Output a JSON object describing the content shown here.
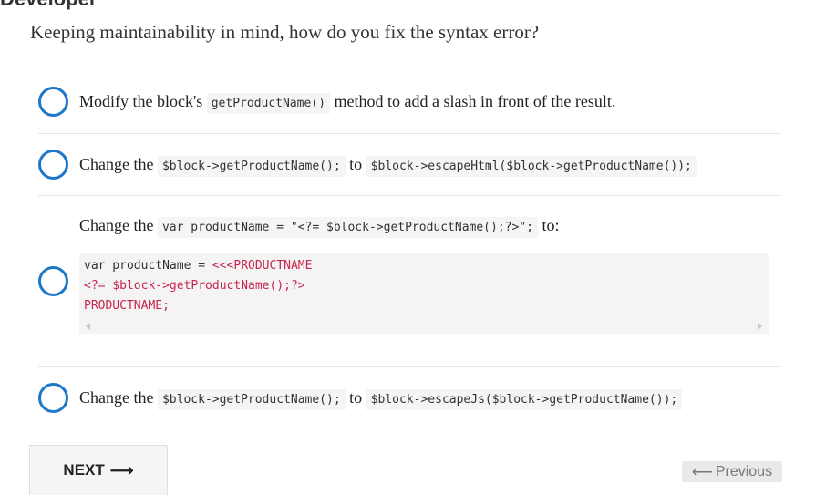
{
  "header": {
    "section_title": "Developer"
  },
  "question": "Keeping maintainability in mind, how do you fix the syntax error?",
  "options": [
    {
      "pre": "Modify the block's ",
      "code1": "getProductName()",
      "post": " method to add a slash in front of the result."
    },
    {
      "pre": "Change the ",
      "code1": "$block->getProductName();",
      "mid": " to ",
      "code2": "$block->escapeHtml($block->getProductName());"
    },
    {
      "pre": "Change the ",
      "code1": "var productName = \"<?= $block->getProductName();?>\";",
      "post": " to:",
      "code_block": {
        "line1_plain": "var productName = ",
        "line1_red": "<<<PRODUCTNAME",
        "line2_red": "<?= $block->getProductName();?>",
        "line3_red": "PRODUCTNAME;"
      }
    },
    {
      "pre": "Change the ",
      "code1": "$block->getProductName();",
      "mid": " to ",
      "code2": "$block->escapeJs($block->getProductName());"
    }
  ],
  "nav": {
    "next_label": "NEXT",
    "next_arrow": "⟶",
    "prev_arrow": "⟵",
    "prev_label": "Previous"
  },
  "colors": {
    "radio": "#1e78c8",
    "code_red": "#c7254e"
  }
}
